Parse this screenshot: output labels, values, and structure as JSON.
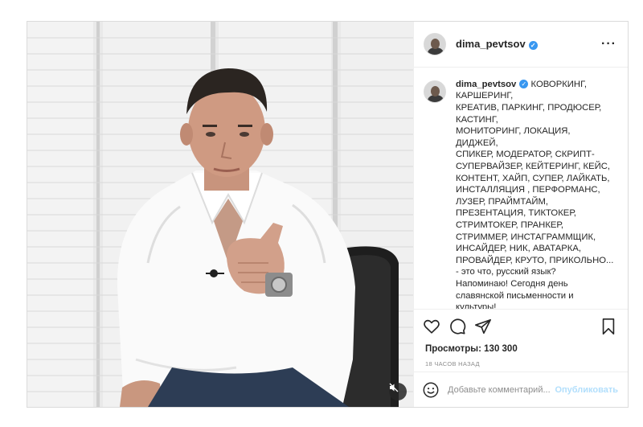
{
  "post": {
    "username": "dima_pevtsov",
    "caption": "КОВОРКИНГ,\nКАРШЕРИНГ,\nКРЕАТИВ, ПАРКИНГ, ПРОДЮСЕР,\nКАСТИНГ,\nМОНИТОРИНГ, ЛОКАЦИЯ, ДИДЖЕЙ,\nСПИКЕР, МОДЕРАТОР, СКРИПТ-\nСУПЕРВАЙЗЕР, КЕЙТЕРИНГ, КЕЙС,\nКОНТЕНТ, ХАЙП, СУПЕР, ЛАЙКАТЬ,\nИНСТАЛЛЯЦИЯ , ПЕРФОРМАНС,\nЛУЗЕР, ПРАЙМТАЙМ,\nПРЕЗЕНТАЦИЯ, ТИКТОКЕР,\nСТРИМТОКЕР, ПРАНКЕР,\nСТРИММЕР, ИНСТАГРАММЩИК,\nИНСАЙДЕР, НИК, АВАТАРКА,\nПРОВАЙДЕР, КРУТО, ПРИКОЛЬНО...\n- это что, русский язык?\nНапоминаю! Сегодня день\nславянской письменности и\nкультуры!",
    "views_label": "Просмотры: 130 300",
    "timestamp": "18 ЧАСОВ НАЗАД",
    "comment_placeholder": "Добавьте комментарий...",
    "publish_label": "Опубликовать",
    "more_label": "···"
  },
  "icons": {
    "verified": "verified-badge-icon",
    "like": "heart-icon",
    "comment": "comment-icon",
    "share": "paper-plane-icon",
    "save": "bookmark-icon",
    "emoji": "smiley-icon",
    "mute": "speaker-muted-icon"
  },
  "colors": {
    "verified_blue": "#3897f0",
    "border": "#dbdbdb",
    "muted_text": "#8e8e8e",
    "publish_disabled": "#b2dffc"
  }
}
